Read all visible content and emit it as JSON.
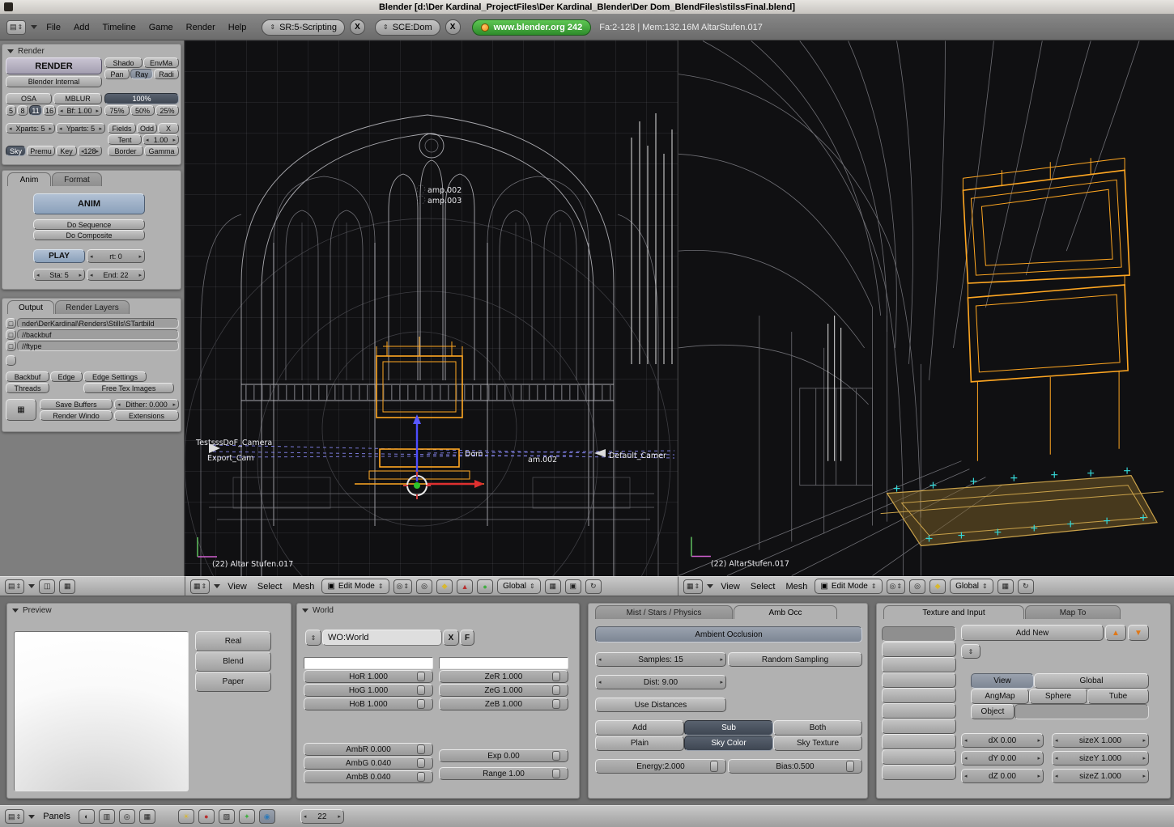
{
  "title_bar": {
    "title": "Blender [d:\\Der Kardinal_ProjectFiles\\Der Kardinal_Blender\\Der Dom_BlendFiles\\stilssFinal.blend]"
  },
  "colors": {
    "accent_orange": "#ffa722",
    "selected_dark": "#3e4652",
    "link_green": "#2e8c2b",
    "marker_cyan": "#35d8d8"
  },
  "menubar": {
    "menus": [
      "File",
      "Add",
      "Timeline",
      "Game",
      "Render",
      "Help"
    ],
    "screen_selector": "SR:5-Scripting",
    "scene_selector": "SCE:Dom",
    "close": "X",
    "site_link": "www.blender.org 242",
    "stats": "Fa:2-128 | Mem:132.16M AltarStufen.017"
  },
  "render_panel": {
    "title": "Render",
    "render": "RENDER",
    "engine": "Blender Internal",
    "shado": "Shado",
    "envma": "EnvMa",
    "pan": "Pan",
    "ray": "Ray",
    "radi": "Radi",
    "osa": "OSA",
    "mblur": "MBLUR",
    "osa5": "5",
    "osa8": "8",
    "osa11": "11",
    "osa16": "16",
    "bf": "Bf: 1.00",
    "p100": "100%",
    "p75": "75%",
    "p50": "50%",
    "p25": "25%",
    "xparts": "Xparts: 5",
    "yparts": "Yparts: 5",
    "fields": "Fields",
    "odd": "Odd",
    "x": "X",
    "tent": "Tent",
    "tent_val": "1.00",
    "sky": "Sky",
    "premu": "Premu",
    "key": "Key",
    "key_val": "128",
    "border": "Border",
    "gamma": "Gamma"
  },
  "anim_panel": {
    "tab1": "Anim",
    "tab2": "Format",
    "anim": "ANIM",
    "do_sequence": "Do Sequence",
    "do_composite": "Do Composite",
    "play": "PLAY",
    "rt": "rt: 0",
    "sta": "Sta: 5",
    "end": "End: 22"
  },
  "output_panel": {
    "tab1": "Output",
    "tab2": "Render Layers",
    "path1": "nder\\DerKardinal\\Renders\\Stills\\STartbild",
    "path2": "//backbuf",
    "path3": "//ftype",
    "backbuf": "Backbuf",
    "edge": "Edge",
    "edge_settings": "Edge Settings",
    "threads": "Threads",
    "free_tex": "Free Tex Images",
    "save_buffers": "Save Buffers",
    "dither": "Dither: 0.000",
    "render_window": "Render Windo",
    "extensions": "Extensions"
  },
  "viewport_header": {
    "view": "View",
    "select": "Select",
    "mesh": "Mesh",
    "mode": "Edit Mode",
    "orientation": "Global"
  },
  "viewport_left": {
    "label": "(22) Altar Stufen.017",
    "cam1": "TestsssDoF_Camera",
    "cam2": "Export_Cam",
    "cam3": "Dom",
    "cam4": "am.002",
    "cam5": "Default_Camer",
    "lamp1": "amp.002",
    "lamp2": "amp.003"
  },
  "viewport_right": {
    "label": "(22) AltarStufen.017"
  },
  "preview_panel": {
    "title": "Preview",
    "real": "Real",
    "blend": "Blend",
    "paper": "Paper"
  },
  "world_panel": {
    "title": "World",
    "datablock": "WO:World",
    "unlink": "X",
    "fake": "F",
    "hor": "HoR 1.000",
    "hog": "HoG 1.000",
    "hob": "HoB 1.000",
    "zer": "ZeR 1.000",
    "zeg": "ZeG 1.000",
    "zeb": "ZeB 1.000",
    "ambr": "AmbR 0.000",
    "ambg": "AmbG 0.040",
    "ambb": "AmbB 0.040",
    "exp": "Exp 0.00",
    "range": "Range 1.00"
  },
  "amb_occ_panel": {
    "tab1": "Mist / Stars / Physics",
    "tab2": "Amb Occ",
    "ao": "Ambient Occlusion",
    "samples": "Samples: 15",
    "random": "Random Sampling",
    "dist": "Dist: 9.00",
    "use_dist": "Use Distances",
    "add": "Add",
    "sub": "Sub",
    "both": "Both",
    "plain": "Plain",
    "sky_color": "Sky Color",
    "sky_texture": "Sky Texture",
    "energy": "Energy:2.000",
    "bias": "Bias:0.500"
  },
  "texture_panel": {
    "tab1": "Texture and Input",
    "tab2": "Map To",
    "add_new": "Add New",
    "view": "View",
    "global": "Global",
    "angmap": "AngMap",
    "sphere": "Sphere",
    "tube": "Tube",
    "object": "Object",
    "dx": "dX 0.00",
    "dy": "dY 0.00",
    "dz": "dZ 0.00",
    "sizex": "sizeX 1.000",
    "sizey": "sizeY 1.000",
    "sizez": "sizeZ 1.000"
  },
  "footer": {
    "panels": "Panels",
    "frame": "22"
  }
}
